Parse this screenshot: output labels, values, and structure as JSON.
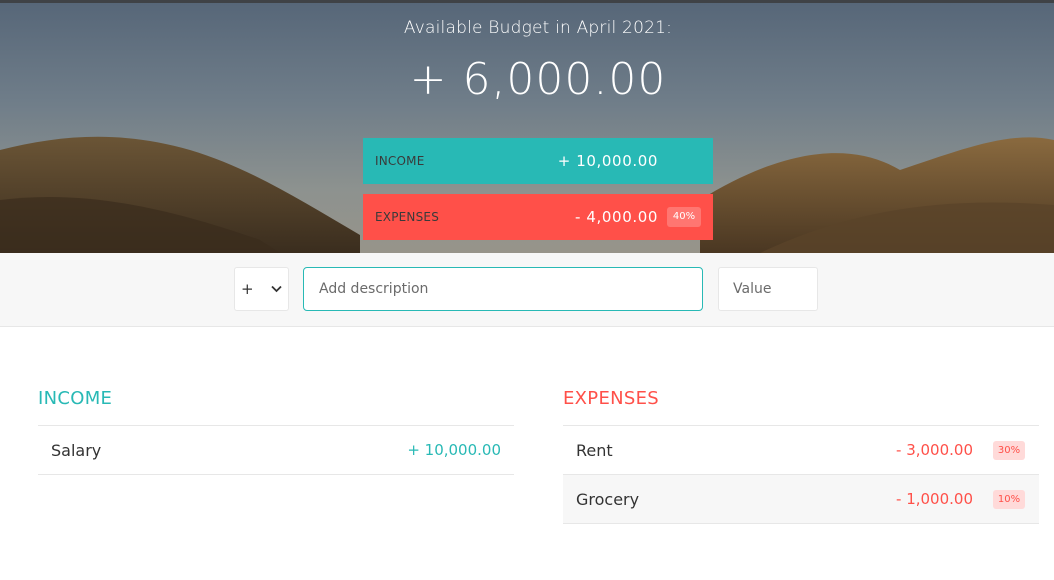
{
  "header": {
    "title": "Available Budget in April 2021:",
    "budget_value": "+ 6,000.00",
    "income": {
      "label": "INCOME",
      "value": "+ 10,000.00"
    },
    "expenses": {
      "label": "EXPENSES",
      "value": "- 4,000.00",
      "percentage": "40%"
    }
  },
  "add_form": {
    "type_selected": "+",
    "type_icon": "chevron-down-icon",
    "description_placeholder": "Add description",
    "value_placeholder": "Value"
  },
  "income_list": {
    "title": "INCOME",
    "items": [
      {
        "description": "Salary",
        "value": "+ 10,000.00"
      }
    ]
  },
  "expenses_list": {
    "title": "EXPENSES",
    "items": [
      {
        "description": "Rent",
        "value": "- 3,000.00",
        "percentage": "30%"
      },
      {
        "description": "Grocery",
        "value": "- 1,000.00",
        "percentage": "10%"
      }
    ]
  },
  "colors": {
    "income_accent": "#28b9b5",
    "expense_accent": "#ff5049"
  }
}
